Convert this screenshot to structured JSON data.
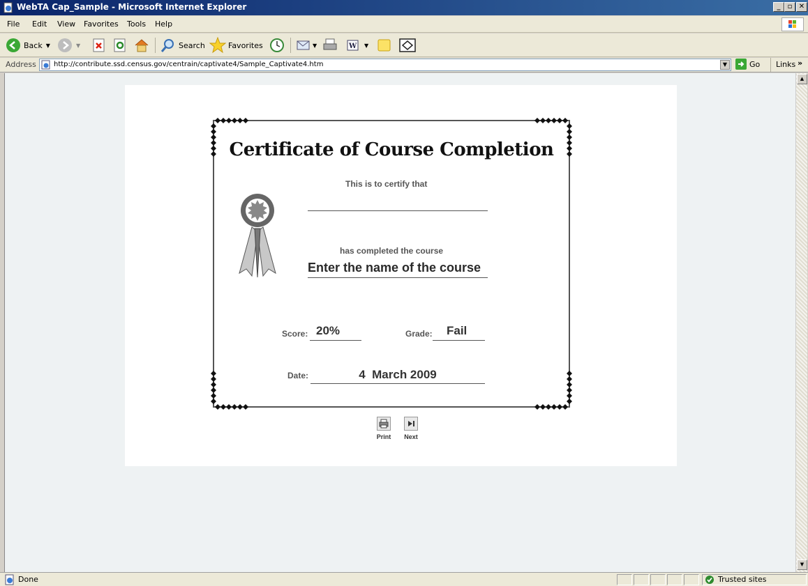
{
  "window": {
    "title": "WebTA Cap_Sample - Microsoft Internet Explorer"
  },
  "menu": {
    "items": [
      "File",
      "Edit",
      "View",
      "Favorites",
      "Tools",
      "Help"
    ]
  },
  "toolbar": {
    "back_label": "Back",
    "search_label": "Search",
    "favorites_label": "Favorites"
  },
  "address": {
    "label": "Address",
    "url": "http://contribute.ssd.census.gov/centrain/captivate4/Sample_Captivate4.htm",
    "go_label": "Go",
    "links_label": "Links",
    "links_more": "»"
  },
  "certificate": {
    "title": "Certificate of Course Completion",
    "certify_text": "This is to certify that",
    "recipient_name": "",
    "completed_text": "has completed the course",
    "course_name": "Enter the name of the course",
    "score_label": "Score:",
    "score_value": "20%",
    "grade_label": "Grade:",
    "grade_value": "Fail",
    "date_label": "Date:",
    "date_value": "4  March 2009"
  },
  "controls": {
    "print_label": "Print",
    "next_label": "Next"
  },
  "status": {
    "text": "Done",
    "zone": "Trusted sites"
  },
  "colors": {
    "titlebar": "#0a246a",
    "page_background": "#eef2f3",
    "certificate_border": "#555555"
  }
}
